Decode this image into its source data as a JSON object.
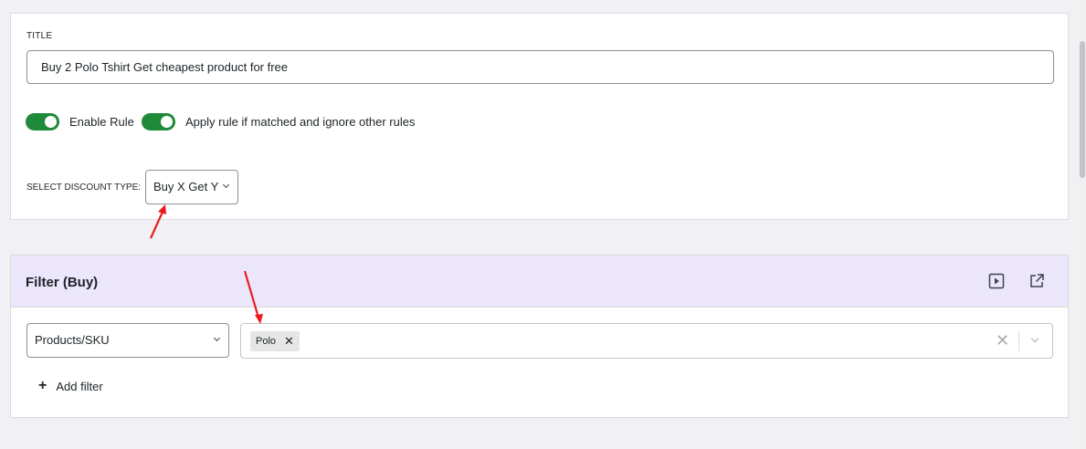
{
  "general": {
    "title_label": "TITLE",
    "title_value": "Buy 2 Polo Tshirt Get cheapest product for free",
    "toggles": [
      {
        "label": "Enable Rule",
        "on": true
      },
      {
        "label": "Apply rule if matched and ignore other rules",
        "on": true
      }
    ],
    "discount_label": "SELECT DISCOUNT TYPE:",
    "discount_value": "Buy X Get Y"
  },
  "filter": {
    "title": "Filter (Buy)",
    "type_value": "Products/SKU",
    "selected_tags": [
      "Polo"
    ],
    "add_filter_label": "Add filter",
    "icons": [
      "play-icon",
      "external-link-icon"
    ]
  },
  "colors": {
    "accent_green": "#1e8a3a",
    "header_lavender": "#ebe6fb",
    "annotation_red": "#e81c1c"
  }
}
